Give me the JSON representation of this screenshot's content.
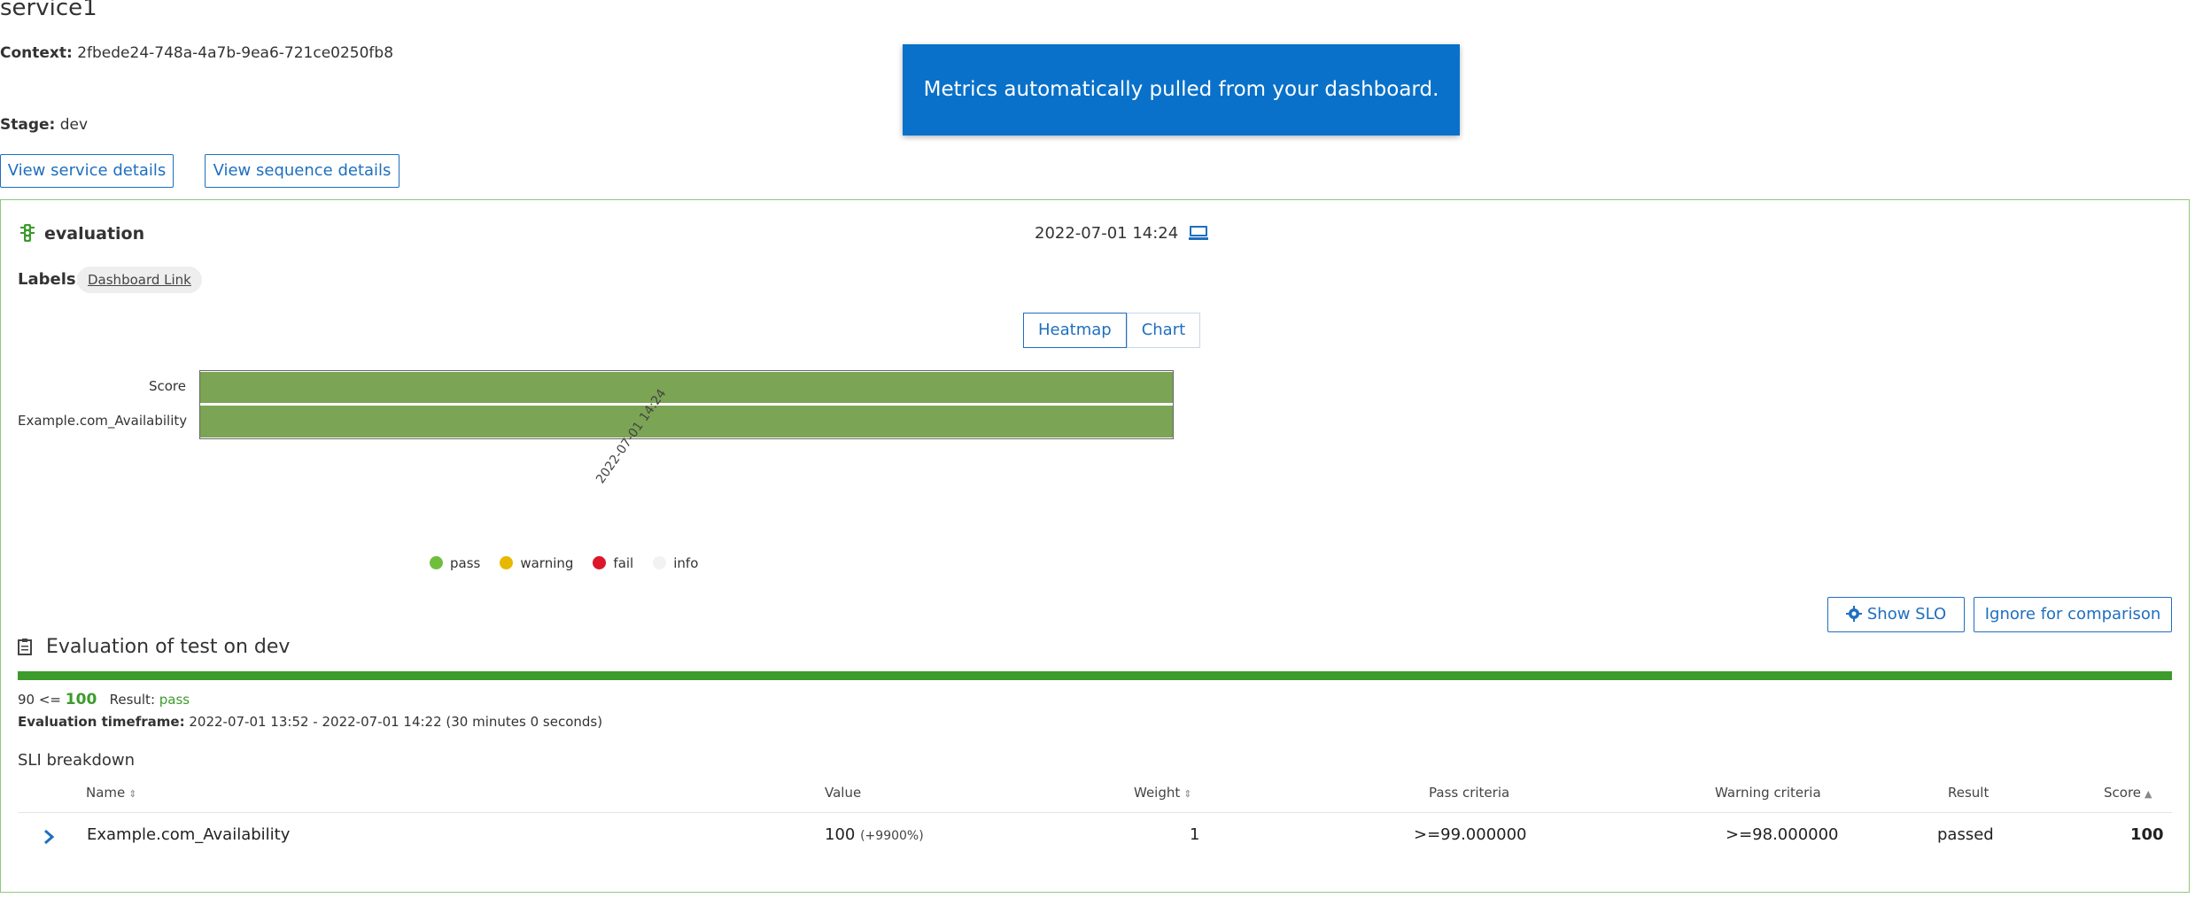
{
  "header": {
    "service": "service1",
    "context_label": "Context:",
    "context_value": "2fbede24-748a-4a7b-9ea6-721ce0250fb8",
    "stage_label": "Stage:",
    "stage_value": "dev"
  },
  "buttons": {
    "service_details": "View service details",
    "sequence_details": "View sequence details",
    "show_slo": "Show SLO",
    "ignore": "Ignore for comparison"
  },
  "toast": {
    "message": "Metrics automatically pulled from your dashboard."
  },
  "evaluation": {
    "title": "evaluation",
    "date": "2022-07-01 14:24",
    "labels_label": "Labels:",
    "label_chip": "Dashboard Link"
  },
  "view_toggle": {
    "heatmap": "Heatmap",
    "chart": "Chart"
  },
  "heatmap": {
    "rows": [
      "Score",
      "Example.com_Availability"
    ],
    "x_tick": "2022-07-01 14:24",
    "cell_color": "#7ba454"
  },
  "legend": [
    {
      "label": "pass",
      "color": "#6fbf3c"
    },
    {
      "label": "warning",
      "color": "#e6b800"
    },
    {
      "label": "fail",
      "color": "#dc172a"
    },
    {
      "label": "info",
      "color": "#f2f2f2"
    }
  ],
  "summary": {
    "title": "Evaluation of test on dev",
    "threshold": "90 <=",
    "score": "100",
    "result_label": "Result:",
    "result_value": "pass",
    "timeframe_label": "Evaluation timeframe:",
    "timeframe_value": "2022-07-01 13:52 - 2022-07-01 14:22 (30 minutes 0 seconds)",
    "progress": 1.0
  },
  "sli": {
    "title": "SLI breakdown",
    "columns": {
      "name": "Name",
      "value": "Value",
      "weight": "Weight",
      "pass": "Pass criteria",
      "warning": "Warning criteria",
      "result": "Result",
      "score": "Score"
    },
    "rows": [
      {
        "name": "Example.com_Availability",
        "value": "100",
        "value_change": "(+9900%)",
        "weight": "1",
        "pass": ">=99.000000",
        "warning": ">=98.000000",
        "result": "passed",
        "score": "100"
      }
    ]
  }
}
